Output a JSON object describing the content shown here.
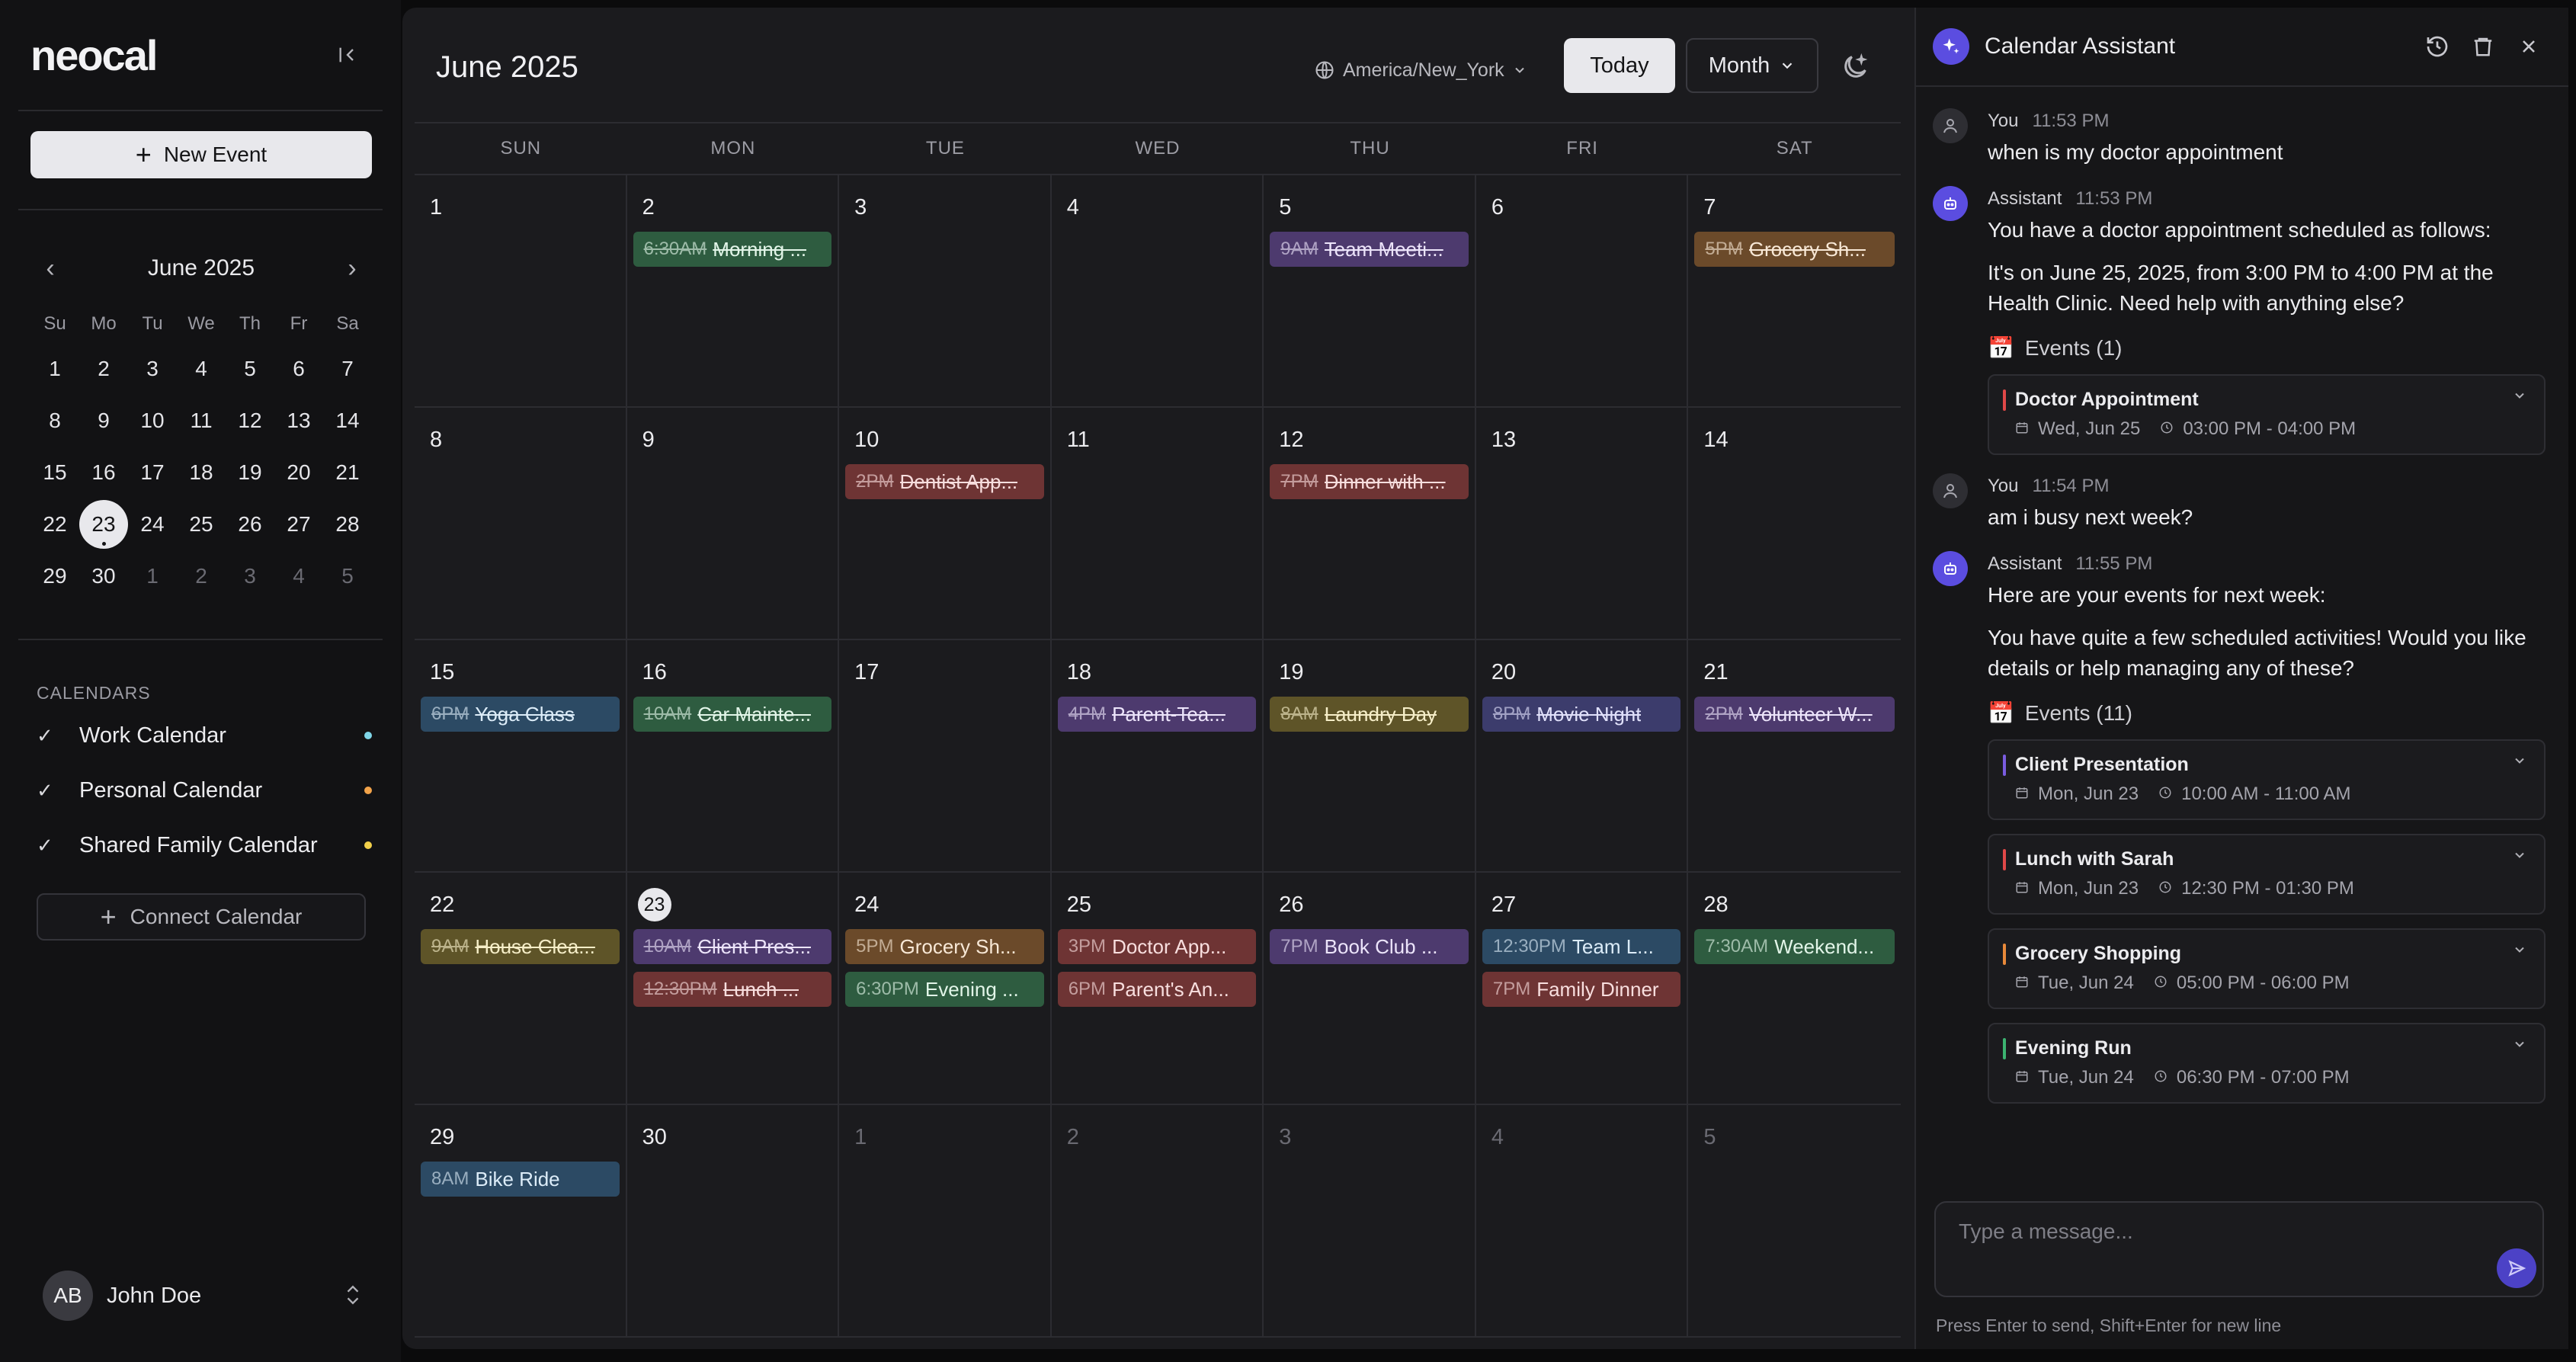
{
  "sidebar": {
    "logo": "neocal",
    "new_event_label": "New Event",
    "mini_calendar": {
      "title": "June 2025",
      "weekdays": [
        "Su",
        "Mo",
        "Tu",
        "We",
        "Th",
        "Fr",
        "Sa"
      ],
      "days": [
        {
          "d": "1"
        },
        {
          "d": "2"
        },
        {
          "d": "3"
        },
        {
          "d": "4"
        },
        {
          "d": "5"
        },
        {
          "d": "6"
        },
        {
          "d": "7"
        },
        {
          "d": "8"
        },
        {
          "d": "9"
        },
        {
          "d": "10"
        },
        {
          "d": "11"
        },
        {
          "d": "12"
        },
        {
          "d": "13"
        },
        {
          "d": "14"
        },
        {
          "d": "15"
        },
        {
          "d": "16"
        },
        {
          "d": "17"
        },
        {
          "d": "18"
        },
        {
          "d": "19"
        },
        {
          "d": "20"
        },
        {
          "d": "21"
        },
        {
          "d": "22"
        },
        {
          "d": "23",
          "today": true
        },
        {
          "d": "24"
        },
        {
          "d": "25"
        },
        {
          "d": "26"
        },
        {
          "d": "27"
        },
        {
          "d": "28"
        },
        {
          "d": "29"
        },
        {
          "d": "30"
        },
        {
          "d": "1",
          "out": true
        },
        {
          "d": "2",
          "out": true
        },
        {
          "d": "3",
          "out": true
        },
        {
          "d": "4",
          "out": true
        },
        {
          "d": "5",
          "out": true
        }
      ]
    },
    "calendars_heading": "CALENDARS",
    "calendars": [
      {
        "label": "Work Calendar",
        "color": "#7fd6e8"
      },
      {
        "label": "Personal Calendar",
        "color": "#f2a34a"
      },
      {
        "label": "Shared Family Calendar",
        "color": "#f2d04a"
      }
    ],
    "connect_label": "Connect Calendar",
    "user": {
      "initials": "AB",
      "name": "John Doe"
    }
  },
  "header": {
    "title": "June 2025",
    "timezone": "America/New_York",
    "today_label": "Today",
    "view_label": "Month"
  },
  "calendar": {
    "weekdays": [
      "SUN",
      "MON",
      "TUE",
      "WED",
      "THU",
      "FRI",
      "SAT"
    ],
    "days": [
      {
        "d": "1",
        "events": []
      },
      {
        "d": "2",
        "events": [
          {
            "time": "6:30AM",
            "name": "Morning ...",
            "color": "green",
            "done": true
          }
        ]
      },
      {
        "d": "3",
        "events": []
      },
      {
        "d": "4",
        "events": []
      },
      {
        "d": "5",
        "events": [
          {
            "time": "9AM",
            "name": "Team Meeti...",
            "color": "purple",
            "done": true
          }
        ]
      },
      {
        "d": "6",
        "events": []
      },
      {
        "d": "7",
        "events": [
          {
            "time": "5PM",
            "name": "Grocery Sh...",
            "color": "orange",
            "done": true
          }
        ]
      },
      {
        "d": "8",
        "events": []
      },
      {
        "d": "9",
        "events": []
      },
      {
        "d": "10",
        "events": [
          {
            "time": "2PM",
            "name": "Dentist App...",
            "color": "red",
            "done": true
          }
        ]
      },
      {
        "d": "11",
        "events": []
      },
      {
        "d": "12",
        "events": [
          {
            "time": "7PM",
            "name": "Dinner with ...",
            "color": "red",
            "done": true
          }
        ]
      },
      {
        "d": "13",
        "events": []
      },
      {
        "d": "14",
        "events": []
      },
      {
        "d": "15",
        "events": [
          {
            "time": "6PM",
            "name": "Yoga Class",
            "color": "blue",
            "done": true
          }
        ]
      },
      {
        "d": "16",
        "events": [
          {
            "time": "10AM",
            "name": "Car Mainte...",
            "color": "green",
            "done": true
          }
        ]
      },
      {
        "d": "17",
        "events": []
      },
      {
        "d": "18",
        "events": [
          {
            "time": "4PM",
            "name": "Parent-Tea...",
            "color": "purple",
            "done": true
          }
        ]
      },
      {
        "d": "19",
        "events": [
          {
            "time": "8AM",
            "name": "Laundry Day",
            "color": "yellow",
            "done": true
          }
        ]
      },
      {
        "d": "20",
        "events": [
          {
            "time": "8PM",
            "name": "Movie Night",
            "color": "indigo",
            "done": true
          }
        ]
      },
      {
        "d": "21",
        "events": [
          {
            "time": "2PM",
            "name": "Volunteer W...",
            "color": "purple",
            "done": true
          }
        ]
      },
      {
        "d": "22",
        "events": [
          {
            "time": "9AM",
            "name": "House Clea...",
            "color": "yellow",
            "done": true
          }
        ]
      },
      {
        "d": "23",
        "today": true,
        "events": [
          {
            "time": "10AM",
            "name": "Client Pres...",
            "color": "purple",
            "done": true
          },
          {
            "time": "12:30PM",
            "name": "Lunch ...",
            "color": "red",
            "done": true
          }
        ]
      },
      {
        "d": "24",
        "events": [
          {
            "time": "5PM",
            "name": "Grocery Sh...",
            "color": "orange",
            "done": false
          },
          {
            "time": "6:30PM",
            "name": "Evening ...",
            "color": "green",
            "done": false
          }
        ]
      },
      {
        "d": "25",
        "events": [
          {
            "time": "3PM",
            "name": "Doctor App...",
            "color": "red",
            "done": false
          },
          {
            "time": "6PM",
            "name": "Parent's An...",
            "color": "red",
            "done": false
          }
        ]
      },
      {
        "d": "26",
        "events": [
          {
            "time": "7PM",
            "name": "Book Club ...",
            "color": "purple",
            "done": false
          }
        ]
      },
      {
        "d": "27",
        "events": [
          {
            "time": "12:30PM",
            "name": "Team L...",
            "color": "blue",
            "done": false
          },
          {
            "time": "7PM",
            "name": "Family Dinner",
            "color": "red",
            "done": false
          }
        ]
      },
      {
        "d": "28",
        "events": [
          {
            "time": "7:30AM",
            "name": "Weekend...",
            "color": "green",
            "done": false
          }
        ]
      },
      {
        "d": "29",
        "events": [
          {
            "time": "8AM",
            "name": "Bike Ride",
            "color": "blue",
            "done": false
          }
        ]
      },
      {
        "d": "30",
        "events": []
      },
      {
        "d": "1",
        "out": true,
        "events": []
      },
      {
        "d": "2",
        "out": true,
        "events": []
      },
      {
        "d": "3",
        "out": true,
        "events": []
      },
      {
        "d": "4",
        "out": true,
        "events": []
      },
      {
        "d": "5",
        "out": true,
        "events": []
      }
    ]
  },
  "assistant": {
    "title": "Calendar Assistant",
    "messages": [
      {
        "role": "user",
        "author": "You",
        "time": "11:53 PM",
        "paragraphs": [
          "when is my doctor appointment"
        ]
      },
      {
        "role": "assistant",
        "author": "Assistant",
        "time": "11:53 PM",
        "paragraphs": [
          "You have a doctor appointment scheduled as follows:",
          "It's on June 25, 2025, from 3:00 PM to 4:00 PM at the Health Clinic. Need help with anything else?"
        ],
        "events_label": "Events (1)",
        "events": [
          {
            "title": "Doctor Appointment",
            "date": "Wed, Jun 25",
            "time": "03:00 PM - 04:00 PM",
            "color": "#e04848"
          }
        ]
      },
      {
        "role": "user",
        "author": "You",
        "time": "11:54 PM",
        "paragraphs": [
          "am i busy next week?"
        ]
      },
      {
        "role": "assistant",
        "author": "Assistant",
        "time": "11:55 PM",
        "paragraphs": [
          "Here are your events for next week:",
          "You have quite a few scheduled activities! Would you like details or help managing any of these?"
        ],
        "events_label": "Events (11)",
        "events": [
          {
            "title": "Client Presentation",
            "date": "Mon, Jun 23",
            "time": "10:00 AM - 11:00 AM",
            "color": "#7a5ce0"
          },
          {
            "title": "Lunch with Sarah",
            "date": "Mon, Jun 23",
            "time": "12:30 PM - 01:30 PM",
            "color": "#e04848"
          },
          {
            "title": "Grocery Shopping",
            "date": "Tue, Jun 24",
            "time": "05:00 PM - 06:00 PM",
            "color": "#e8893a"
          },
          {
            "title": "Evening Run",
            "date": "Tue, Jun 24",
            "time": "06:30 PM - 07:00 PM",
            "color": "#3cb371"
          }
        ]
      }
    ],
    "input_placeholder": "Type a message...",
    "hint": "Press Enter to send, Shift+Enter for new line"
  }
}
